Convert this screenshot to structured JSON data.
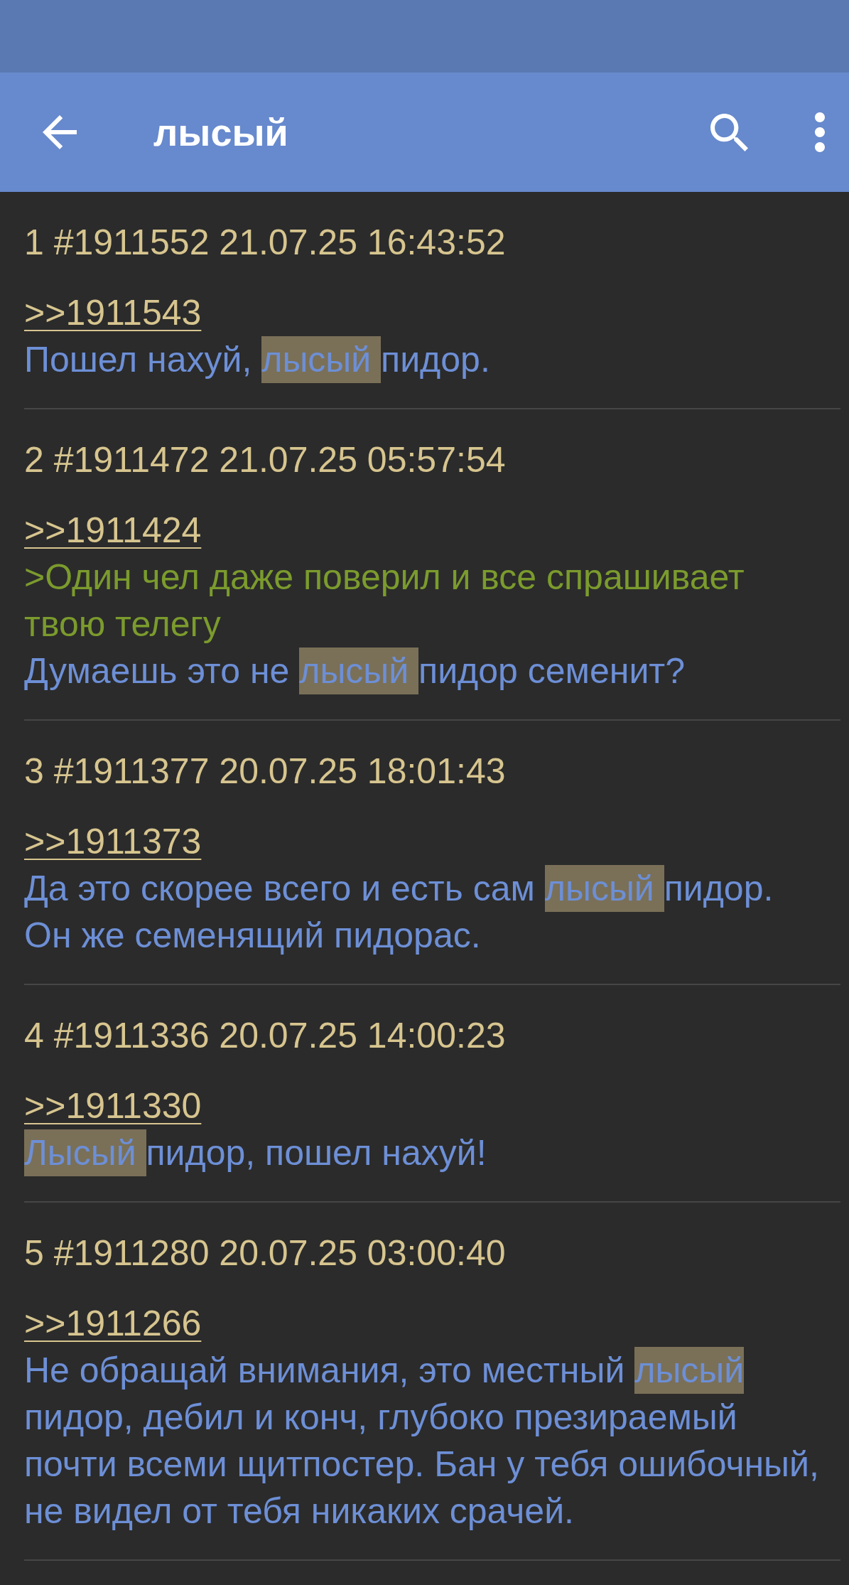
{
  "app_bar": {
    "title": "лысый"
  },
  "posts": [
    {
      "header": "1 #1911552 21.07.25 16:43:52",
      "reply_link": ">>1911543",
      "lines": [
        {
          "kind": "text",
          "parts": [
            {
              "kind": "plain",
              "text": "Пошел нахуй, "
            },
            {
              "kind": "highlight",
              "text": "лысый "
            },
            {
              "kind": "plain",
              "text": "пидор."
            }
          ]
        }
      ]
    },
    {
      "header": "2 #1911472 21.07.25 05:57:54",
      "reply_link": ">>1911424",
      "lines": [
        {
          "kind": "quote",
          "parts": [
            {
              "kind": "plain",
              "text": ">Один чел даже поверил и все спрашивает твою телегу"
            }
          ]
        },
        {
          "kind": "text",
          "parts": [
            {
              "kind": "plain",
              "text": "Думаешь это не "
            },
            {
              "kind": "highlight",
              "text": "лысый "
            },
            {
              "kind": "plain",
              "text": "пидор семенит?"
            }
          ]
        }
      ]
    },
    {
      "header": "3 #1911377 20.07.25 18:01:43",
      "reply_link": ">>1911373",
      "lines": [
        {
          "kind": "text",
          "parts": [
            {
              "kind": "plain",
              "text": "Да это скорее всего и есть сам "
            },
            {
              "kind": "highlight",
              "text": "лысый "
            },
            {
              "kind": "plain",
              "text": "пидор."
            }
          ]
        },
        {
          "kind": "text",
          "parts": [
            {
              "kind": "plain",
              "text": "Он же семенящий пидорас."
            }
          ]
        }
      ]
    },
    {
      "header": "4 #1911336 20.07.25 14:00:23",
      "reply_link": ">>1911330",
      "lines": [
        {
          "kind": "text",
          "parts": [
            {
              "kind": "highlight",
              "text": "Лысый "
            },
            {
              "kind": "plain",
              "text": "пидор, пошел нахуй!"
            }
          ]
        }
      ]
    },
    {
      "header": "5 #1911280 20.07.25 03:00:40",
      "reply_link": ">>1911266",
      "lines": [
        {
          "kind": "text",
          "parts": [
            {
              "kind": "plain",
              "text": "Не обращай внимания, это местный "
            },
            {
              "kind": "highlight",
              "text": "лысый "
            },
            {
              "kind": "plain",
              "text": "пидор, дебил и конч, глубоко презираемый почти всеми щитпостер. Бан у тебя ошибочный, не видел от тебя никаких срачей."
            }
          ]
        }
      ]
    }
  ]
}
